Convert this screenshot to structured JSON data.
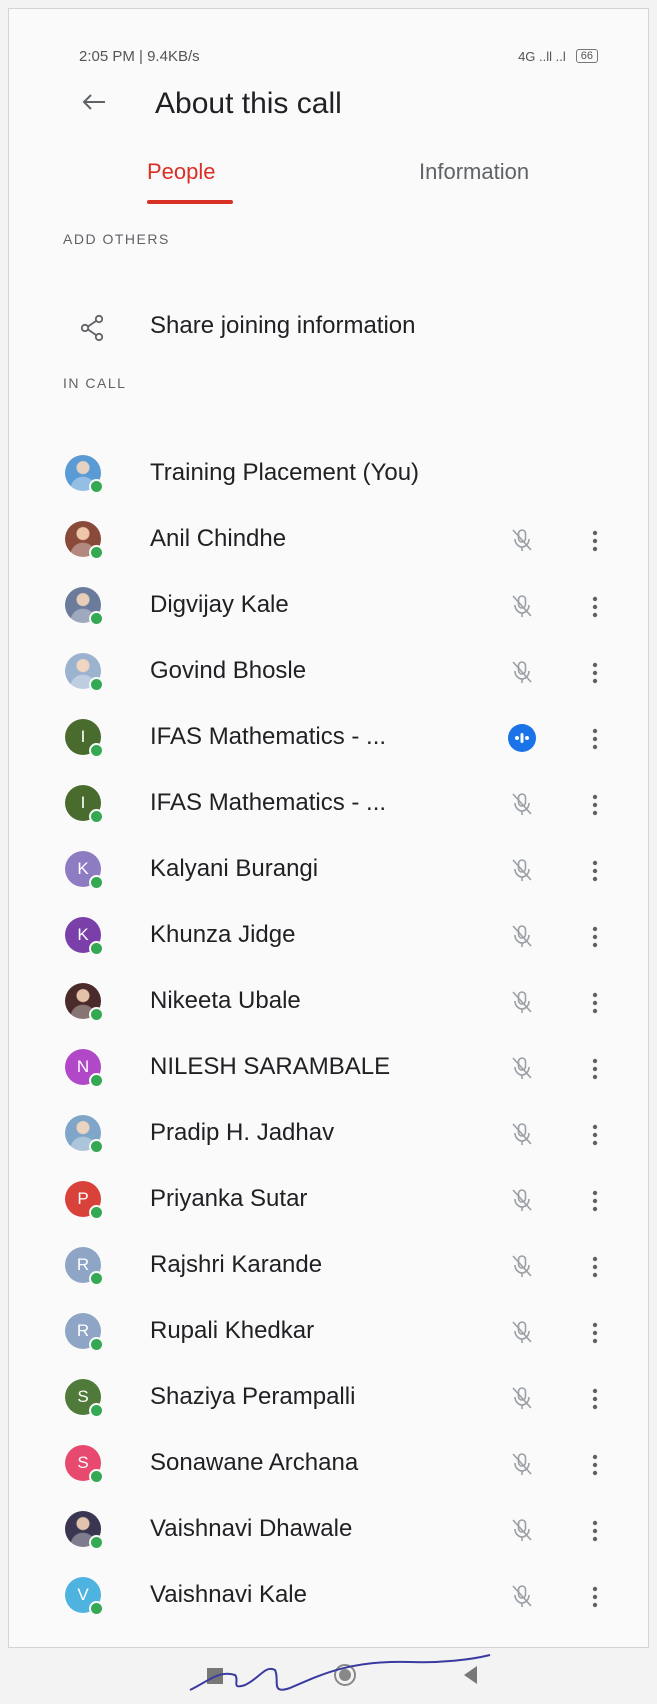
{
  "status_bar": {
    "time": "2:05 PM | 9.4KB/s",
    "network": "4G ..ll ..l",
    "battery": "66"
  },
  "header": {
    "title": "About this call"
  },
  "tabs": [
    {
      "label": "People",
      "active": true
    },
    {
      "label": "Information",
      "active": false
    }
  ],
  "add_others": {
    "section_label": "ADD OTHERS",
    "share_label": "Share joining information"
  },
  "in_call": {
    "section_label": "IN CALL",
    "participants": [
      {
        "name": "Training Placement (You)",
        "initial": "",
        "avatar_color": "#5b9bd5",
        "photo": true,
        "mic": "none"
      },
      {
        "name": "Anil Chindhe",
        "initial": "",
        "avatar_color": "#8a4a3a",
        "photo": true,
        "mic": "muted"
      },
      {
        "name": "Digvijay Kale",
        "initial": "",
        "avatar_color": "#6a7b9c",
        "photo": true,
        "mic": "muted"
      },
      {
        "name": "Govind Bhosle",
        "initial": "",
        "avatar_color": "#9cb3d0",
        "photo": true,
        "mic": "muted"
      },
      {
        "name": "IFAS Mathematics - ...",
        "initial": "I",
        "avatar_color": "#4a6b2e",
        "photo": false,
        "mic": "speaking"
      },
      {
        "name": "IFAS Mathematics - ...",
        "initial": "I",
        "avatar_color": "#4a6b2e",
        "photo": false,
        "mic": "muted"
      },
      {
        "name": "Kalyani Burangi",
        "initial": "K",
        "avatar_color": "#8e7cc3",
        "photo": false,
        "mic": "muted"
      },
      {
        "name": "Khunza Jidge",
        "initial": "K",
        "avatar_color": "#7a3fa8",
        "photo": false,
        "mic": "muted"
      },
      {
        "name": "Nikeeta Ubale",
        "initial": "",
        "avatar_color": "#4a2a2a",
        "photo": true,
        "mic": "muted"
      },
      {
        "name": "NILESH SARAMBALE",
        "initial": "N",
        "avatar_color": "#b048c8",
        "photo": false,
        "mic": "muted"
      },
      {
        "name": "Pradip H. Jadhav",
        "initial": "",
        "avatar_color": "#7fa6c8",
        "photo": true,
        "mic": "muted"
      },
      {
        "name": "Priyanka Sutar",
        "initial": "P",
        "avatar_color": "#d9413b",
        "photo": false,
        "mic": "muted"
      },
      {
        "name": "Rajshri Karande",
        "initial": "R",
        "avatar_color": "#8fa5c6",
        "photo": false,
        "mic": "muted"
      },
      {
        "name": "Rupali Khedkar",
        "initial": "R",
        "avatar_color": "#8fa5c6",
        "photo": false,
        "mic": "muted"
      },
      {
        "name": "Shaziya Perampalli",
        "initial": "S",
        "avatar_color": "#4f7a3a",
        "photo": false,
        "mic": "muted"
      },
      {
        "name": "Sonawane Archana",
        "initial": "S",
        "avatar_color": "#e84a6f",
        "photo": false,
        "mic": "muted"
      },
      {
        "name": "Vaishnavi Dhawale",
        "initial": "",
        "avatar_color": "#3a3550",
        "photo": true,
        "mic": "muted"
      },
      {
        "name": "Vaishnavi Kale",
        "initial": "V",
        "avatar_color": "#4fb3e0",
        "photo": false,
        "mic": "muted"
      }
    ]
  },
  "icons": {
    "back": "arrow-left-icon",
    "share": "share-icon",
    "muted": "mic-off-icon",
    "speaking": "audio-level-icon",
    "more": "more-vert-icon"
  },
  "colors": {
    "accent": "#d93025",
    "speaking": "#1a73e8",
    "online": "#34a853",
    "text": "#202124",
    "secondary_text": "#5f6368"
  }
}
